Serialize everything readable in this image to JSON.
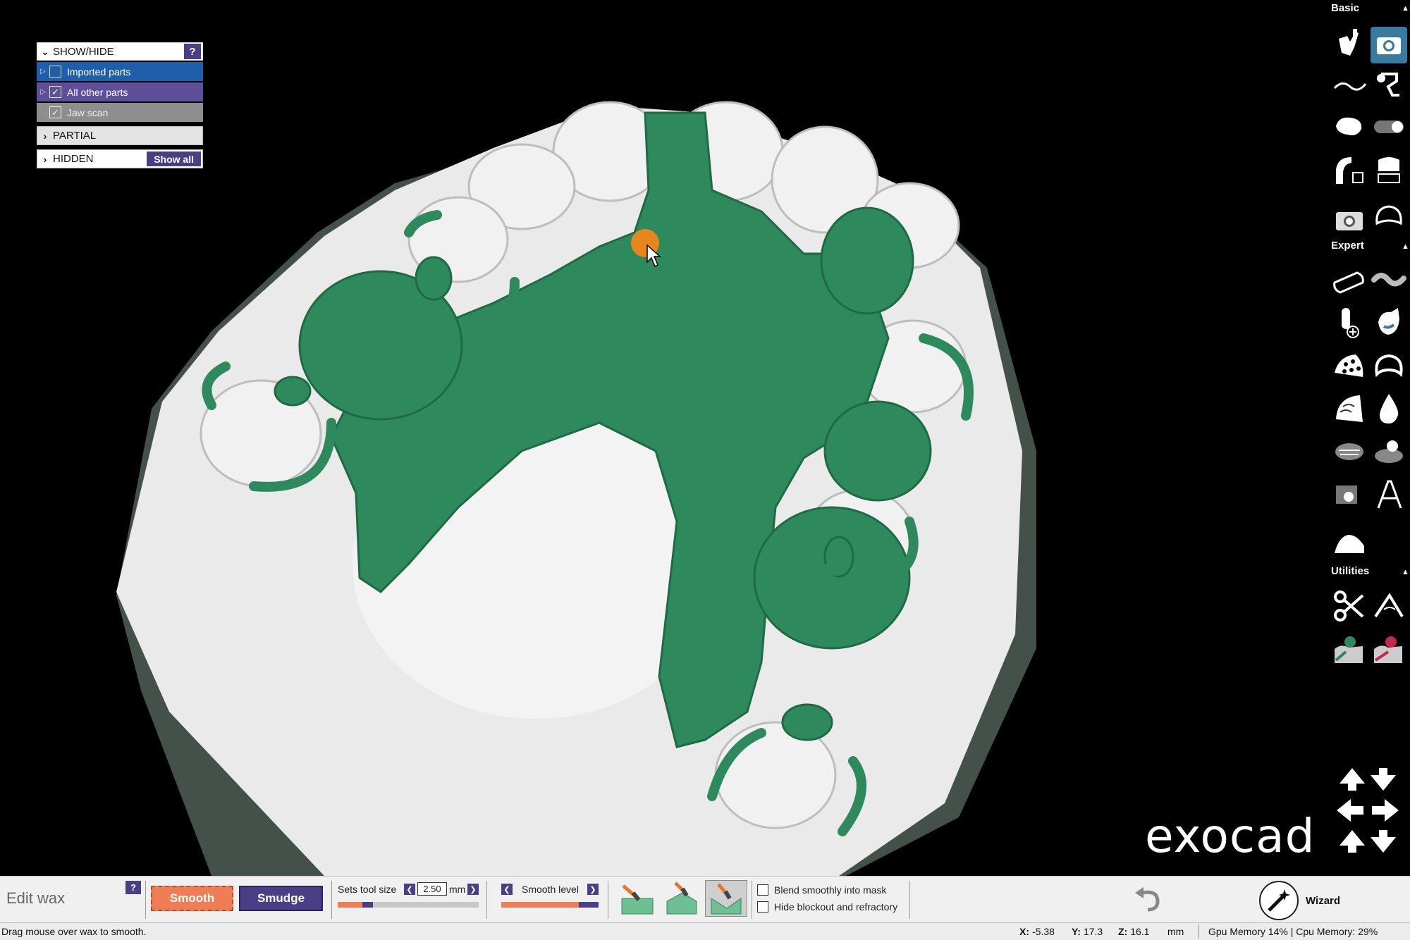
{
  "show_hide_panel": {
    "header": "SHOW/HIDE",
    "help": "?",
    "items": [
      {
        "label": "Imported parts",
        "checked": false
      },
      {
        "label": "All other parts",
        "checked": true
      },
      {
        "label": "Jaw scan",
        "checked": true
      }
    ],
    "partial": "PARTIAL",
    "hidden": "HIDDEN",
    "show_all": "Show all"
  },
  "toolbar": {
    "basic": "Basic",
    "expert": "Expert",
    "utilities": "Utilities"
  },
  "logo": "exocad",
  "bottom": {
    "mode_label": "Edit wax",
    "help": "?",
    "smooth": "Smooth",
    "smudge": "Smudge",
    "tool_size_label": "Sets tool size",
    "tool_size_value": "2.50",
    "tool_size_unit": "mm",
    "tool_size_fraction": 0.25,
    "smooth_level_label": "Smooth level",
    "smooth_level_fraction": 0.8,
    "blend_label": "Blend smoothly into mask",
    "blend_checked": false,
    "hide_blockout_label": "Hide blockout and refractory",
    "hide_blockout_checked": false,
    "wizard": "Wizard"
  },
  "status": {
    "message": "Drag mouse over wax to smooth.",
    "x_label": "X:",
    "x_value": "-5.38",
    "y_label": "Y:",
    "y_value": "17.3",
    "z_label": "Z:",
    "z_value": "16.1",
    "unit": "mm",
    "memory": "Gpu Memory 14% | Cpu Memory: 29%"
  },
  "colors": {
    "wax_green": "#2e8a5c",
    "model_white": "#e8e8e8",
    "accent_orange": "#ef7d56",
    "accent_purple": "#4a3f86",
    "cursor_orange": "#e9851f"
  }
}
